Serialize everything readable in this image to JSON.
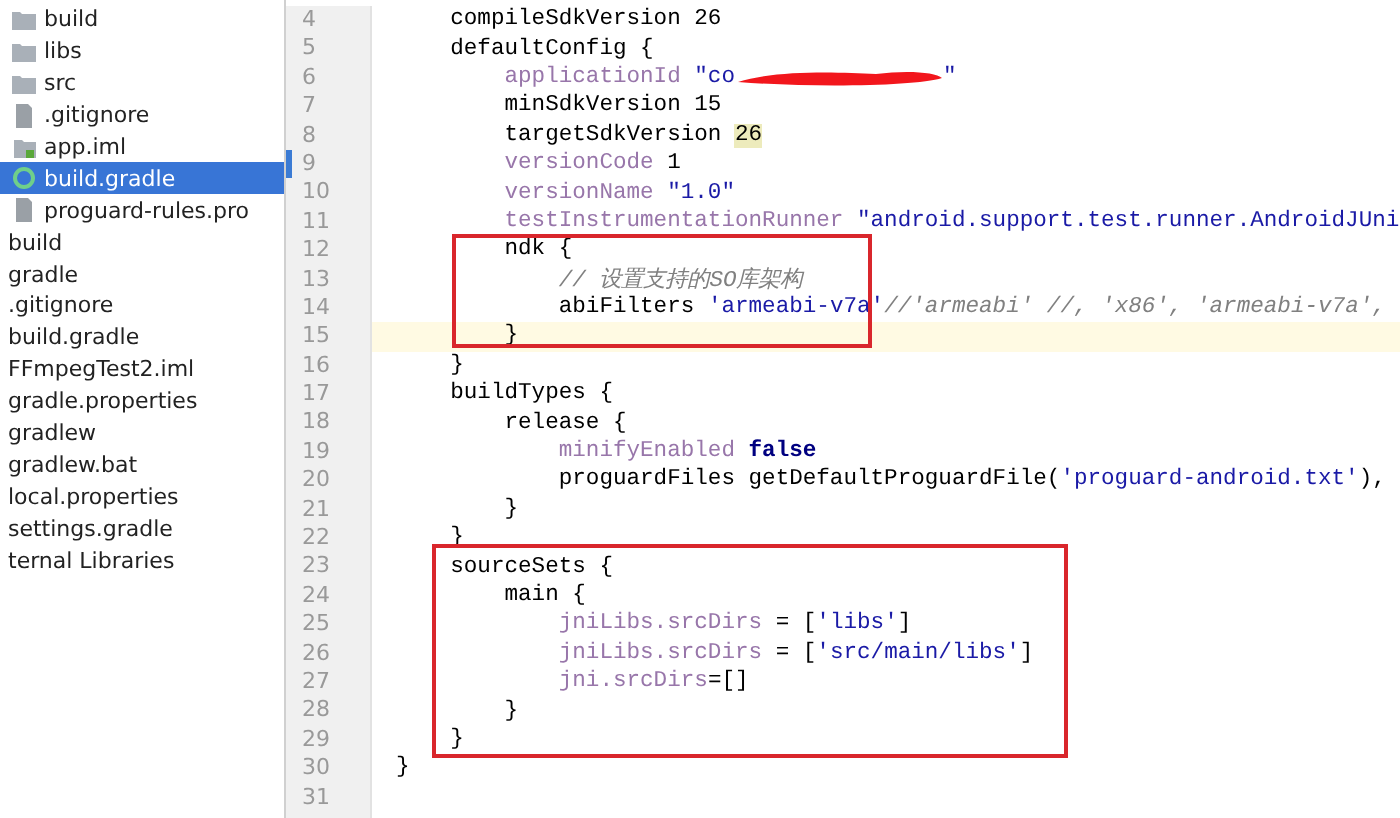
{
  "project_tree": {
    "module_items": [
      {
        "label": "build",
        "kind": "folder",
        "selected": false
      },
      {
        "label": "libs",
        "kind": "folder",
        "selected": false
      },
      {
        "label": "src",
        "kind": "folder",
        "selected": false
      },
      {
        "label": ".gitignore",
        "kind": "file",
        "selected": false
      },
      {
        "label": "app.iml",
        "kind": "module",
        "selected": false
      },
      {
        "label": "build.gradle",
        "kind": "gradle",
        "selected": true
      },
      {
        "label": "proguard-rules.pro",
        "kind": "file",
        "selected": false
      }
    ],
    "root_items": [
      {
        "label": "build",
        "selected": false
      },
      {
        "label": "gradle",
        "selected": false
      },
      {
        "label": ".gitignore",
        "selected": false
      },
      {
        "label": "build.gradle",
        "selected": false
      },
      {
        "label": "FFmpegTest2.iml",
        "selected": false
      },
      {
        "label": "gradle.properties",
        "selected": false
      },
      {
        "label": "gradlew",
        "selected": false
      },
      {
        "label": "gradlew.bat",
        "selected": false
      },
      {
        "label": "local.properties",
        "selected": false
      },
      {
        "label": "settings.gradle",
        "selected": false
      },
      {
        "label": "ternal Libraries",
        "selected": false
      }
    ]
  },
  "editor": {
    "lines": [
      {
        "number": "4",
        "current": false,
        "segments": [
          {
            "kind": "plain",
            "text": "    compileSdkVersion 26"
          }
        ]
      },
      {
        "number": "5",
        "current": false,
        "segments": [
          {
            "kind": "plain",
            "text": "    defaultConfig {"
          }
        ]
      },
      {
        "number": "6",
        "current": false,
        "segments": [
          {
            "kind": "prop",
            "text": "        applicationId"
          },
          {
            "kind": "str",
            "text": " \"co"
          },
          {
            "kind": "redaction"
          },
          {
            "kind": "str",
            "text": "\""
          }
        ]
      },
      {
        "number": "7",
        "current": false,
        "segments": [
          {
            "kind": "plain",
            "text": "        minSdkVersion 15"
          }
        ]
      },
      {
        "number": "8",
        "current": false,
        "segments": [
          {
            "kind": "plain",
            "text": "        targetSdkVersion "
          },
          {
            "kind": "hl",
            "text": "26"
          }
        ]
      },
      {
        "number": "9",
        "current": false,
        "segments": [
          {
            "kind": "prop",
            "text": "        versionCode"
          },
          {
            "kind": "plain",
            "text": " 1"
          }
        ]
      },
      {
        "number": "10",
        "current": false,
        "segments": [
          {
            "kind": "prop",
            "text": "        versionName"
          },
          {
            "kind": "str",
            "text": " \"1.0\""
          }
        ]
      },
      {
        "number": "11",
        "current": false,
        "segments": [
          {
            "kind": "prop",
            "text": "        testInstrumentationRunner"
          },
          {
            "kind": "str",
            "text": " \"android.support.test.runner.AndroidJUni"
          }
        ]
      },
      {
        "number": "12",
        "current": false,
        "segments": [
          {
            "kind": "plain",
            "text": "        ndk {"
          }
        ]
      },
      {
        "number": "13",
        "current": false,
        "segments": [
          {
            "kind": "comment",
            "text": "            // 设置支持的SO库架构"
          }
        ]
      },
      {
        "number": "14",
        "current": false,
        "segments": [
          {
            "kind": "plain",
            "text": "            abiFilters "
          },
          {
            "kind": "str",
            "text": "'armeabi-v7a'"
          },
          {
            "kind": "comment",
            "text": "//'armeabi' //, 'x86', 'armeabi-v7a',"
          }
        ]
      },
      {
        "number": "15",
        "current": true,
        "segments": [
          {
            "kind": "plain",
            "text": "        }"
          }
        ]
      },
      {
        "number": "16",
        "current": false,
        "segments": [
          {
            "kind": "plain",
            "text": "    }"
          }
        ]
      },
      {
        "number": "17",
        "current": false,
        "segments": [
          {
            "kind": "plain",
            "text": "    buildTypes {"
          }
        ]
      },
      {
        "number": "18",
        "current": false,
        "segments": [
          {
            "kind": "plain",
            "text": "        release {"
          }
        ]
      },
      {
        "number": "19",
        "current": false,
        "segments": [
          {
            "kind": "prop",
            "text": "            minifyEnabled"
          },
          {
            "kind": "kw",
            "text": " false"
          }
        ]
      },
      {
        "number": "20",
        "current": false,
        "segments": [
          {
            "kind": "plain",
            "text": "            proguardFiles getDefaultProguardFile("
          },
          {
            "kind": "str",
            "text": "'proguard-android.txt'"
          },
          {
            "kind": "plain",
            "text": "),"
          }
        ]
      },
      {
        "number": "21",
        "current": false,
        "segments": [
          {
            "kind": "plain",
            "text": "        }"
          }
        ]
      },
      {
        "number": "22",
        "current": false,
        "segments": [
          {
            "kind": "plain",
            "text": "    }"
          }
        ]
      },
      {
        "number": "23",
        "current": false,
        "segments": [
          {
            "kind": "plain",
            "text": "    sourceSets {"
          }
        ]
      },
      {
        "number": "24",
        "current": false,
        "segments": [
          {
            "kind": "plain",
            "text": "        main {"
          }
        ]
      },
      {
        "number": "25",
        "current": false,
        "segments": [
          {
            "kind": "prop",
            "text": "            jniLibs.srcDirs"
          },
          {
            "kind": "plain",
            "text": " = ["
          },
          {
            "kind": "str",
            "text": "'libs'"
          },
          {
            "kind": "plain",
            "text": "]"
          }
        ]
      },
      {
        "number": "26",
        "current": false,
        "segments": [
          {
            "kind": "prop",
            "text": "            jniLibs.srcDirs"
          },
          {
            "kind": "plain",
            "text": " = ["
          },
          {
            "kind": "str",
            "text": "'src/main/libs'"
          },
          {
            "kind": "plain",
            "text": "]"
          }
        ]
      },
      {
        "number": "27",
        "current": false,
        "segments": [
          {
            "kind": "prop",
            "text": "            jni.srcDirs"
          },
          {
            "kind": "plain",
            "text": "=[]"
          }
        ]
      },
      {
        "number": "28",
        "current": false,
        "segments": [
          {
            "kind": "plain",
            "text": "        }"
          }
        ]
      },
      {
        "number": "29",
        "current": false,
        "segments": [
          {
            "kind": "plain",
            "text": "    }"
          }
        ]
      },
      {
        "number": "30",
        "current": false,
        "segments": [
          {
            "kind": "plain",
            "text": "}"
          }
        ]
      },
      {
        "number": "31"
      }
    ]
  }
}
